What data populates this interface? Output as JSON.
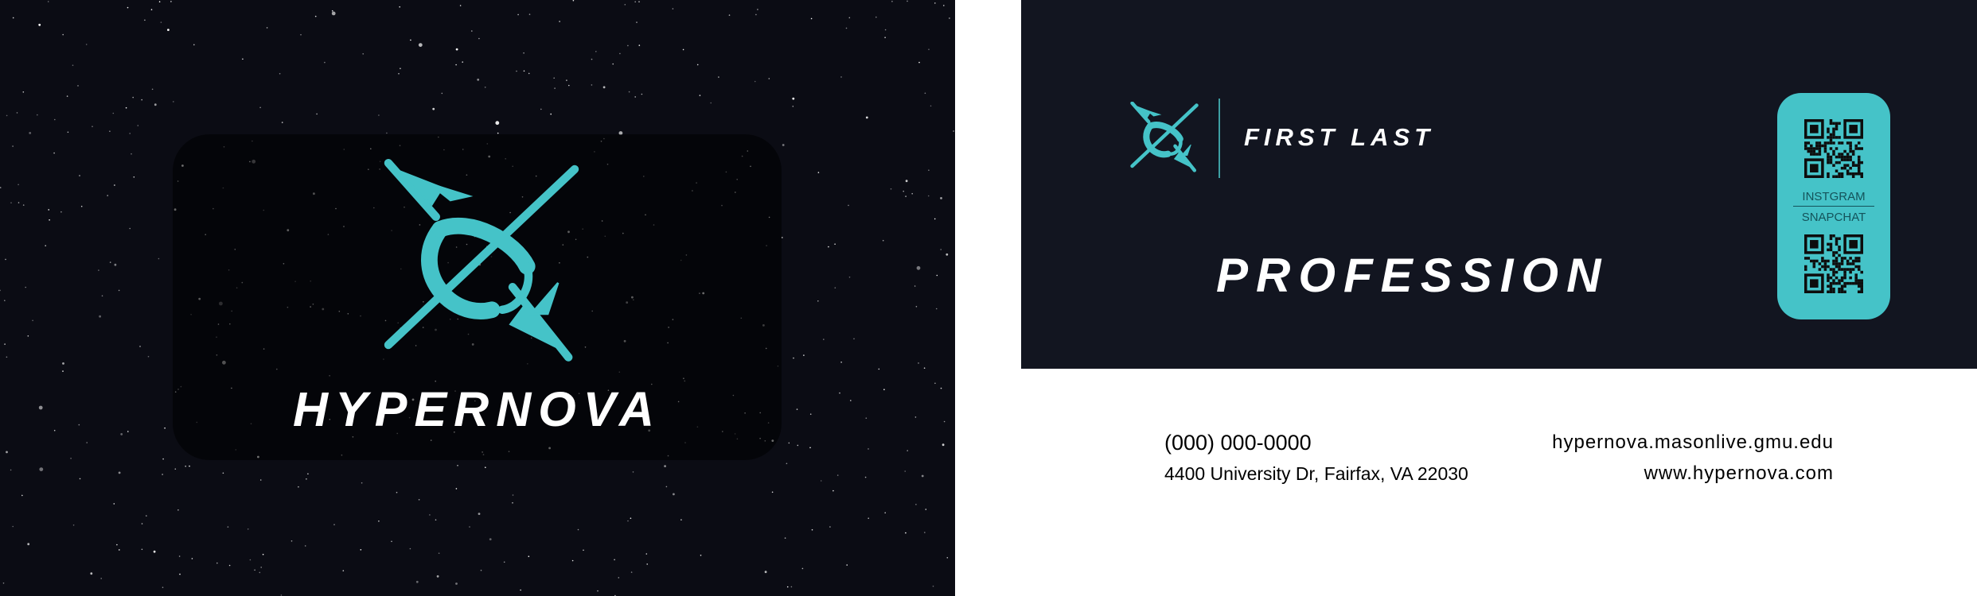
{
  "front": {
    "brand_name": "HYPERNOVA",
    "logo_icon": "hypernova-planet-logo-icon"
  },
  "back": {
    "name": "FIRST LAST",
    "profession": "PROFESSION",
    "logo_icon": "hypernova-planet-logo-icon",
    "social": {
      "top_label": "INSTGRAM",
      "bottom_label": "SNAPCHAT",
      "qr_icon": "qr-code-icon"
    },
    "contact": {
      "phone": "(000) 000-0000",
      "address": "4400 University Dr, Fairfax, VA 22030",
      "website_1": "hypernova.masonlive.gmu.edu",
      "website_2": "www.hypernova.com"
    }
  },
  "colors": {
    "accent_teal": "#45c3c8",
    "dark_navy": "#121520",
    "space_black": "#0b0c14",
    "white": "#ffffff"
  }
}
